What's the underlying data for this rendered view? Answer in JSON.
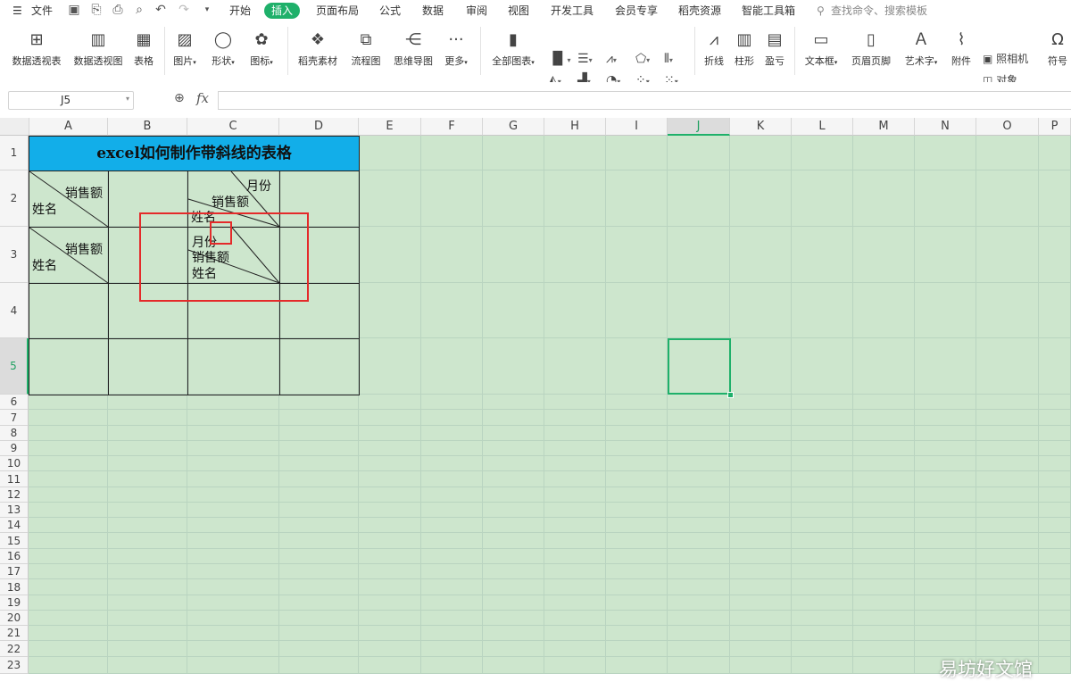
{
  "menu": {
    "file": "文件",
    "tabs": [
      "开始",
      "插入",
      "页面布局",
      "公式",
      "数据",
      "审阅",
      "视图",
      "开发工具",
      "会员专享",
      "稻壳资源",
      "智能工具箱"
    ],
    "active_tab": "插入",
    "search_placeholder": "查找命令、搜索模板"
  },
  "ribbon": {
    "big_buttons": [
      {
        "label": "数据透视表",
        "icon": "pivot-table-icon"
      },
      {
        "label": "数据透视图",
        "icon": "pivot-chart-icon"
      },
      {
        "label": "表格",
        "icon": "table-icon"
      },
      {
        "label": "图片",
        "icon": "picture-icon",
        "dropdown": true
      },
      {
        "label": "形状",
        "icon": "shape-icon",
        "dropdown": true
      },
      {
        "label": "图标",
        "icon": "icons-icon",
        "dropdown": true
      },
      {
        "label": "稻壳素材",
        "icon": "material-icon"
      },
      {
        "label": "流程图",
        "icon": "flowchart-icon"
      },
      {
        "label": "思维导图",
        "icon": "mindmap-icon"
      },
      {
        "label": "更多",
        "icon": "more-icon",
        "dropdown": true
      },
      {
        "label": "全部图表",
        "icon": "all-charts-icon",
        "dropdown": true
      },
      {
        "label": "折线",
        "icon": "sparkline-line-icon"
      },
      {
        "label": "柱形",
        "icon": "sparkline-column-icon"
      },
      {
        "label": "盈亏",
        "icon": "sparkline-winloss-icon"
      },
      {
        "label": "文本框",
        "icon": "textbox-icon",
        "dropdown": true
      },
      {
        "label": "页眉页脚",
        "icon": "header-footer-icon"
      },
      {
        "label": "艺术字",
        "icon": "wordart-icon",
        "dropdown": true
      },
      {
        "label": "附件",
        "icon": "attachment-icon"
      },
      {
        "label": "符号",
        "icon": "symbol-icon"
      }
    ],
    "camera_label": "照相机",
    "object_label": "对象"
  },
  "formula_bar": {
    "cell_ref": "J5",
    "fx": "fx",
    "formula": ""
  },
  "columns": [
    "A",
    "B",
    "C",
    "D",
    "E",
    "F",
    "G",
    "H",
    "I",
    "J",
    "K",
    "L",
    "M",
    "N",
    "O",
    "P"
  ],
  "rows": [
    "1",
    "2",
    "3",
    "4",
    "5",
    "6",
    "7",
    "8",
    "9",
    "10",
    "11",
    "12",
    "13",
    "14",
    "15",
    "16",
    "17",
    "18",
    "19",
    "20",
    "21",
    "22",
    "23"
  ],
  "selected": {
    "column": "J",
    "row": "5"
  },
  "sheet": {
    "title": "excel如何制作带斜线的表格",
    "a2_top": "销售额",
    "a2_bottom": "姓名",
    "a3_top": "销售额",
    "a3_bottom": "姓名",
    "c2_top": "月份",
    "c2_middle": "销售额",
    "c2_bottom": "姓名",
    "c3_line1": "月份",
    "c3_line2": "销售额",
    "c3_line3": "姓名"
  },
  "watermark": "易坊好文馆",
  "colors": {
    "accent": "#1fb06a",
    "title_fill": "#12aee9",
    "sheet_bg": "#cde6cd",
    "annotation": "#e42a2a"
  }
}
